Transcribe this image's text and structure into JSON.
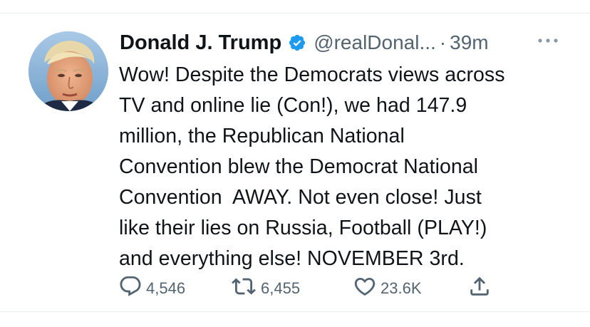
{
  "tweet": {
    "author": {
      "name": "Donald J. Trump",
      "handle": "@realDonal...",
      "verified": true
    },
    "separator": "·",
    "timestamp": "39m",
    "text": "Wow! Despite the Democrats views across\nTV and online lie (Con!), we had 147.9\nmillion, the Republican National\nConvention blew the Democrat National\nConvention  AWAY. Not even close! Just\nlike their lies on Russia, Football (PLAY!)\nand everything else! NOVEMBER 3rd.",
    "stats": {
      "replies": "4,546",
      "retweets": "6,455",
      "likes": "23.6K"
    }
  },
  "icons": {
    "verified": "verified-badge-icon",
    "more": "more-options-icon",
    "reply": "reply-icon",
    "retweet": "retweet-icon",
    "like": "heart-icon",
    "share": "share-icon"
  },
  "colors": {
    "text": "#0f1419",
    "secondary": "#536471",
    "verified": "#1d9bf0",
    "divider": "#e6ecf0"
  }
}
